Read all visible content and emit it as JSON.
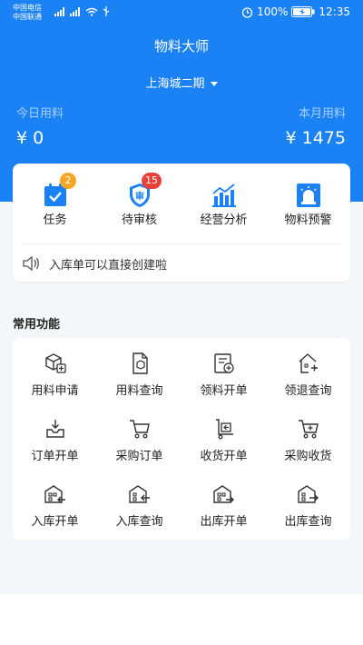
{
  "statusbar": {
    "carrier1": "中国电信",
    "carrier2": "中国联通",
    "battery": "100%",
    "time": "12:35"
  },
  "header": {
    "title": "物料大师",
    "project": "上海城二期"
  },
  "stats": {
    "today_label": "今日用料",
    "today_value": "¥ 0",
    "month_label": "本月用料",
    "month_value": "¥ 1475"
  },
  "quick": {
    "task_label": "任务",
    "task_badge": "2",
    "review_label": "待审核",
    "review_badge": "15",
    "analysis_label": "经营分析",
    "warning_label": "物料预警",
    "notice": "入库单可以直接创建啦"
  },
  "section": {
    "title": "常用功能"
  },
  "functions": {
    "f1": "用料申请",
    "f2": "用料查询",
    "f3": "领料开单",
    "f4": "领退查询",
    "f5": "订单开单",
    "f6": "采购订单",
    "f7": "收货开单",
    "f8": "采购收货",
    "f9": "入库开单",
    "f10": "入库查询",
    "f11": "出库开单",
    "f12": "出库查询"
  },
  "colors": {
    "brand": "#1a82f5",
    "badge_orange": "#f5a623",
    "badge_red": "#e6423b"
  }
}
